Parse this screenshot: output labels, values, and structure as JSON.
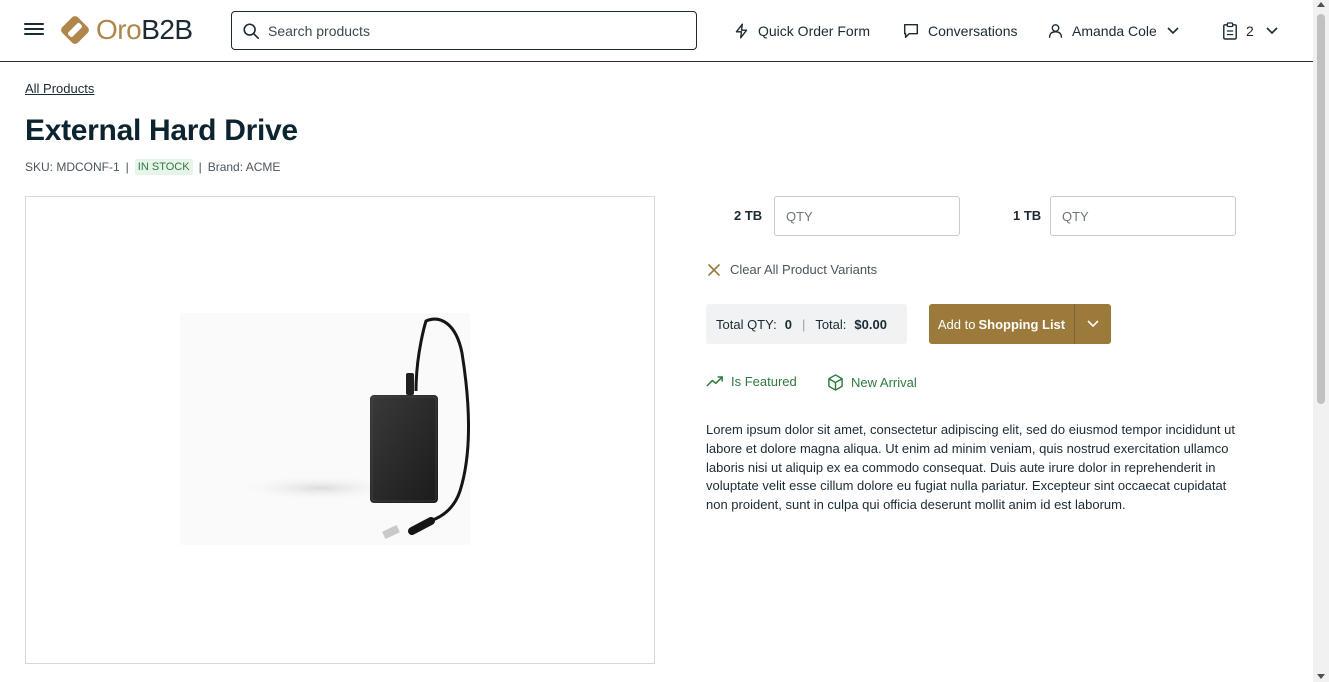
{
  "header": {
    "logo_oro": "Oro",
    "logo_b2b": "B2B",
    "search_placeholder": "Search products",
    "quick_order": "Quick Order Form",
    "conversations": "Conversations",
    "user_name": "Amanda Cole",
    "cart_count": "2"
  },
  "breadcrumb": "All Products",
  "product": {
    "title": "External Hard Drive",
    "sku": "SKU: MDCONF-1",
    "stock": "In Stock",
    "brand": "Brand: ACME",
    "variants": [
      {
        "label": "2 TB",
        "placeholder": "QTY"
      },
      {
        "label": "1 TB",
        "placeholder": "QTY"
      }
    ],
    "clear_variants": "Clear All Product Variants",
    "total_qty_label": "Total QTY:",
    "total_qty_value": "0",
    "total_label": "Total:",
    "total_value": "$0.00",
    "add_to_prefix": "Add to",
    "add_to_target": "Shopping List",
    "labels": [
      "Is Featured",
      "New Arrival"
    ],
    "description": "Lorem ipsum dolor sit amet, consectetur adipiscing elit, sed do eiusmod tempor incididunt ut labore et dolore magna aliqua. Ut enim ad minim veniam, quis nostrud exercitation ullamco laboris nisi ut aliquip ex ea commodo consequat. Duis aute irure dolor in reprehenderit in voluptate velit esse cillum dolore eu fugiat nulla pariatur. Excepteur sint occaecat cupidatat non proident, sunt in culpa qui officia deserunt mollit anim id est laborum."
  },
  "colors": {
    "brand": "#b0874a",
    "button": "#9b7a3b",
    "in_stock": "#2f7a3f",
    "text": "#0b2430"
  }
}
